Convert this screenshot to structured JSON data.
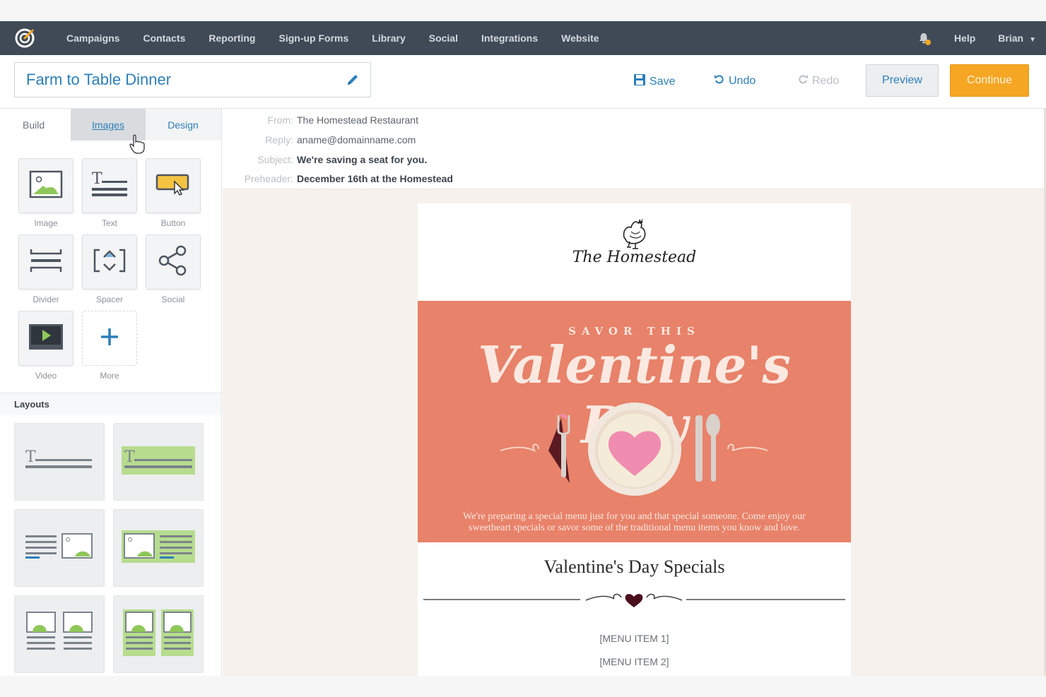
{
  "topnav": {
    "items": [
      "Campaigns",
      "Contacts",
      "Reporting",
      "Sign-up Forms",
      "Library",
      "Social",
      "Integrations",
      "Website"
    ],
    "help": "Help",
    "user": "Brian"
  },
  "toolbar": {
    "title": "Farm to Table Dinner",
    "save": "Save",
    "undo": "Undo",
    "redo": "Redo",
    "preview": "Preview",
    "continue": "Continue"
  },
  "sidebar": {
    "tabs": [
      "Build",
      "Images",
      "Design"
    ],
    "blocks": [
      "Image",
      "Text",
      "Button",
      "Divider",
      "Spacer",
      "Social",
      "Video",
      "More"
    ],
    "layouts_title": "Layouts"
  },
  "header_fields": {
    "from_label": "From:",
    "from": "The Homestead Restaurant",
    "reply_label": "Reply:",
    "reply": "aname@domainname.com",
    "subject_label": "Subject:",
    "subject": "We're saving a seat for you.",
    "preheader_label": "Preheader:",
    "preheader": "December 16th at the Homestead"
  },
  "email": {
    "brand": "The Homestead",
    "kicker": "SAVOR THIS",
    "headline": "Valentine's Day",
    "hero_text_1": "We're preparing a special menu just for you and that special someone. Come enjoy our",
    "hero_text_2": "sweetheart specials or savor some of the traditional menu items you know and love.",
    "specials_title": "Valentine's Day Specials",
    "menu_item_1": "[MENU ITEM 1]",
    "menu_item_2": "[MENU ITEM 2]"
  },
  "colors": {
    "nav_bg": "#3f4a56",
    "accent_blue": "#2d7fb8",
    "continue_orange": "#f5a623",
    "hero_coral": "#e8826a",
    "heart_pink": "#f08cb0"
  }
}
